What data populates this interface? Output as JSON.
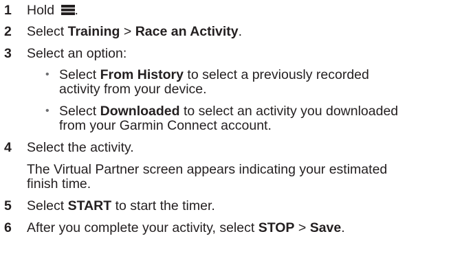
{
  "steps": [
    {
      "number": "1",
      "text_before": "Hold ",
      "icon": "menu-icon",
      "text_after": "."
    },
    {
      "number": "2",
      "text_before": "Select ",
      "bold_1": "Training",
      "sep": " > ",
      "bold_2": "Race an Activity",
      "text_after": "."
    },
    {
      "number": "3",
      "text": "Select an option:",
      "options": [
        {
          "prefix": "Select ",
          "bold": "From History",
          "suffix_line1": " to select a previously recorded",
          "line2": "activity from your device."
        },
        {
          "prefix": "Select ",
          "bold": "Downloaded",
          "suffix_line1": " to select an activity you downloaded",
          "line2": "from your Garmin Connect account."
        }
      ]
    },
    {
      "number": "4",
      "text": "Select the activity.",
      "note_line1": "The Virtual Partner screen appears indicating your estimated",
      "note_line2": "finish time."
    },
    {
      "number": "5",
      "text_before": "Select ",
      "bold": "START",
      "text_after": " to start the timer."
    },
    {
      "number": "6",
      "text_before": "After you complete your activity, select ",
      "bold_1": "STOP",
      "sep": " > ",
      "bold_2": "Save",
      "text_after": "."
    }
  ],
  "bullet_char": "•",
  "colors": {
    "text": "#231f20",
    "bullet": "#6d6e71"
  }
}
